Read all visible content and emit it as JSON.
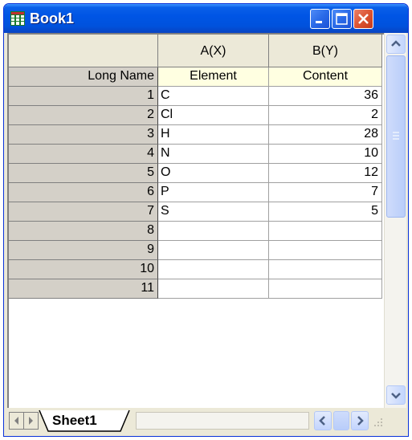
{
  "window": {
    "title": "Book1"
  },
  "columns": [
    {
      "label": "A(X)",
      "long_name": "Element"
    },
    {
      "label": "B(Y)",
      "long_name": "Content"
    }
  ],
  "long_name_label": "Long Name",
  "rows": [
    {
      "num": "1",
      "a": "C",
      "b": "36"
    },
    {
      "num": "2",
      "a": "Cl",
      "b": "2"
    },
    {
      "num": "3",
      "a": "H",
      "b": "28"
    },
    {
      "num": "4",
      "a": "N",
      "b": "10"
    },
    {
      "num": "5",
      "a": "O",
      "b": "12"
    },
    {
      "num": "6",
      "a": "P",
      "b": "7"
    },
    {
      "num": "7",
      "a": "S",
      "b": "5"
    },
    {
      "num": "8",
      "a": "",
      "b": ""
    },
    {
      "num": "9",
      "a": "",
      "b": ""
    },
    {
      "num": "10",
      "a": "",
      "b": ""
    },
    {
      "num": "11",
      "a": "",
      "b": ""
    }
  ],
  "sheet_tab": {
    "label": "Sheet1"
  },
  "colors": {
    "titlebar": "#0055e5",
    "close_button": "#dc5533",
    "long_name_row": "#ffffe1"
  },
  "icons": [
    "workbook-icon",
    "minimize-icon",
    "maximize-icon",
    "close-icon",
    "scroll-up-icon",
    "scroll-down-icon",
    "scroll-left-icon",
    "scroll-right-icon",
    "tab-first-icon",
    "tab-next-icon",
    "size-grip-icon"
  ]
}
